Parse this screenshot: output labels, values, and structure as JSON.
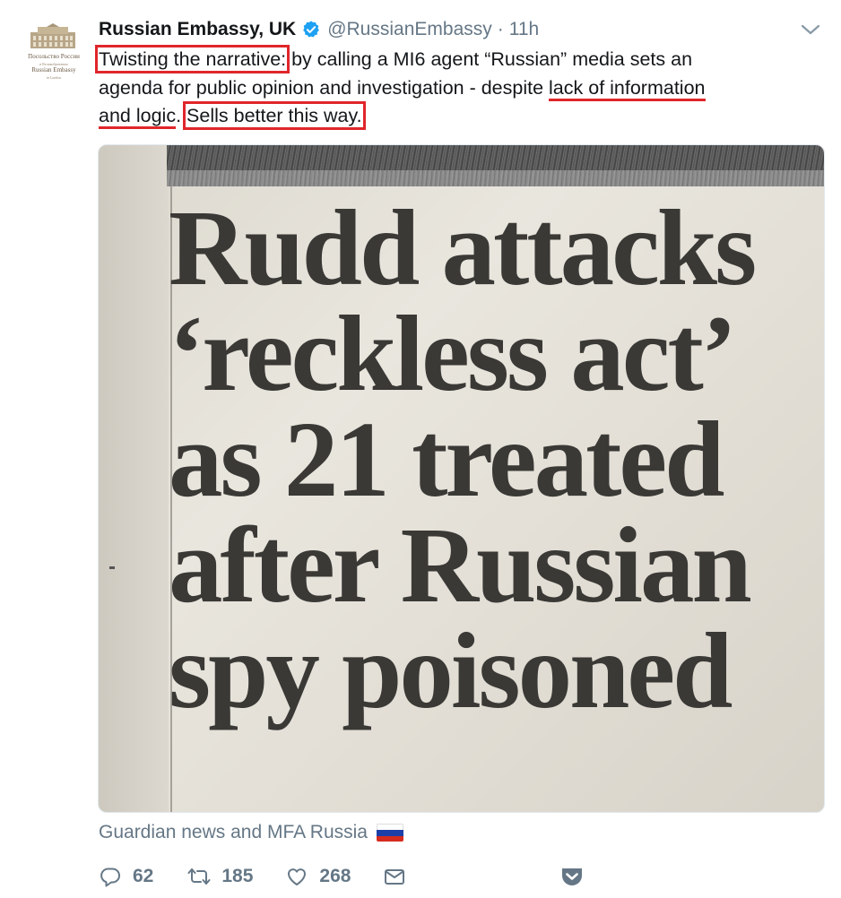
{
  "tweet": {
    "author_name": "Russian Embassy, UK",
    "handle": "@RussianEmbassy",
    "separator": "·",
    "time": "11h",
    "avatar": {
      "line1": "Посольство России",
      "line2": "в Великобритании",
      "line3": "Russian Embassy",
      "line4": "in London"
    },
    "text": {
      "l1_box1": "Twisting the narrative:",
      "l1_rest": " by calling a MI6 agent “Russian” media sets an",
      "l2_plain": "agenda for public opinion and investigation - despite ",
      "l2_ul": "lack of information",
      "l3_ul": "and logic",
      "l3_dot": ". ",
      "l3_box2": "Sells better this way."
    },
    "headline": [
      "Rudd attacks",
      "‘reckless act’",
      "as 21 treated",
      "after Russian",
      "spy poisoned"
    ],
    "caption": "Guardian news and MFA Russia",
    "flag_colors": [
      "#ffffff",
      "#1c3fa8",
      "#d52b1e"
    ],
    "actions": {
      "reply_count": "62",
      "retweet_count": "185",
      "like_count": "268"
    },
    "icons": [
      "verified-badge-icon",
      "caret-down-icon",
      "reply-icon",
      "retweet-icon",
      "like-icon",
      "direct-message-icon",
      "pocket-icon"
    ],
    "colors": {
      "annotation_red": "#e0262b",
      "secondary_gray": "#657786",
      "verified_blue": "#1da1f2",
      "save_icon_gray": "#657786"
    }
  }
}
